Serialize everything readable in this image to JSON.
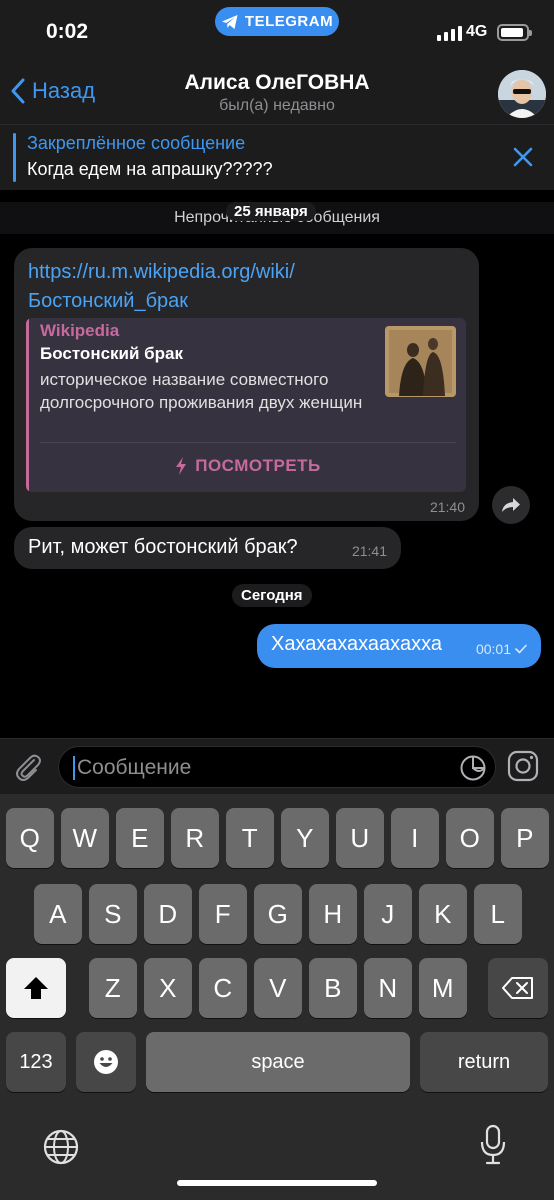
{
  "status_bar": {
    "time": "0:02",
    "app_pill": "TELEGRAM",
    "network": "4G"
  },
  "header": {
    "back_label": "Назад",
    "title": "Алиса ОлеГОВНА",
    "subtitle": "был(а) недавно"
  },
  "pinned": {
    "title": "Закреплённое сообщение",
    "text": "Когда едем на апрашку?????"
  },
  "chat": {
    "unread_label": "Непрочитанные сообщения",
    "date_label": "25 января",
    "today_label": "Сегодня",
    "link_message": {
      "url_line1": "https://ru.m.wikipedia.org/wiki/",
      "url_line2": "Бостонский_брак",
      "preview_site": "Wikipedia",
      "preview_title": "Бостонский брак",
      "preview_desc": "историческое название совместного долгосрочного проживания двух женщин",
      "preview_action": "ПОСМОТРЕТЬ",
      "time": "21:40"
    },
    "text_message": {
      "text": "Рит, может бостонский брак?",
      "time": "21:41"
    },
    "out_message": {
      "text": "Хахахахахаахахха",
      "time": "00:01"
    }
  },
  "composer": {
    "placeholder": "Сообщение"
  },
  "keyboard": {
    "row1": [
      "Q",
      "W",
      "E",
      "R",
      "T",
      "Y",
      "U",
      "I",
      "O",
      "P"
    ],
    "row2": [
      "A",
      "S",
      "D",
      "F",
      "G",
      "H",
      "J",
      "K",
      "L"
    ],
    "row3": [
      "Z",
      "X",
      "C",
      "V",
      "B",
      "N",
      "M"
    ],
    "numbers_label": "123",
    "space_label": "space",
    "return_label": "return"
  },
  "colors": {
    "accent": "#3e98f1",
    "outgoing": "#3a8ef0",
    "incoming": "#262628",
    "preview_accent": "#c66a9e"
  }
}
